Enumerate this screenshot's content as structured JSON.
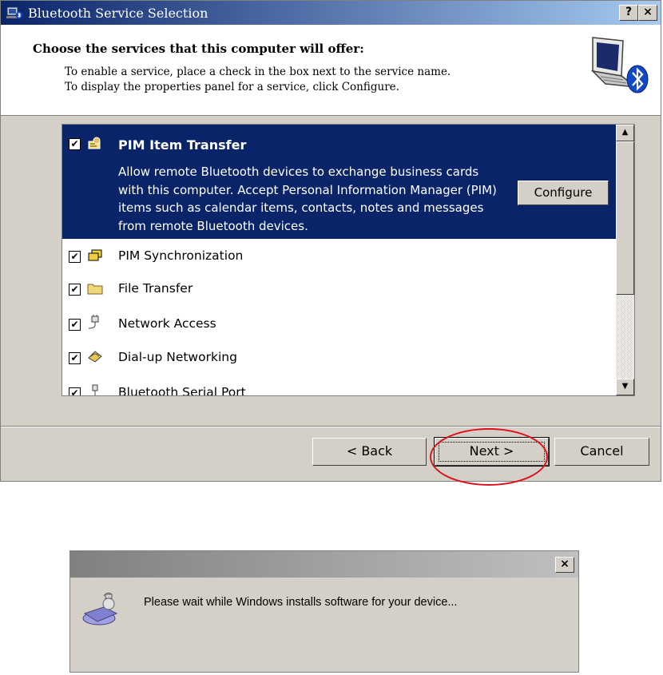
{
  "dialog": {
    "title": "Bluetooth Service Selection",
    "help_button": "?",
    "close_button": "×",
    "header_title": "Choose the services that this computer will offer:",
    "header_line1": "To enable a service, place a check in the box next to the service name.",
    "header_line2": "To display the properties panel for a service, click Configure."
  },
  "services": {
    "selected": {
      "label": "PIM Item Transfer",
      "checked": true,
      "description": "Allow remote Bluetooth devices to exchange business cards with this computer. Accept Personal Information Manager (PIM) items such as calendar items, contacts, notes and messages from remote Bluetooth devices.",
      "configure_label": "Configure"
    },
    "items": [
      {
        "label": "PIM Synchronization",
        "checked": true,
        "icon": "pim-sync-icon"
      },
      {
        "label": "File Transfer",
        "checked": true,
        "icon": "folder-icon"
      },
      {
        "label": "Network Access",
        "checked": true,
        "icon": "network-plug-icon"
      },
      {
        "label": "Dial-up Networking",
        "checked": true,
        "icon": "modem-icon"
      },
      {
        "label": "Bluetooth Serial Port",
        "checked": true,
        "icon": "serial-plug-icon"
      }
    ]
  },
  "buttons": {
    "back": "< Back",
    "next": "Next >",
    "cancel": "Cancel"
  },
  "install_dialog": {
    "close_button": "×",
    "message": "Please wait while Windows installs software for your device..."
  },
  "colors": {
    "selection": "#0a246a",
    "face": "#d4d0c8",
    "highlight_circle": "#e0101a"
  }
}
